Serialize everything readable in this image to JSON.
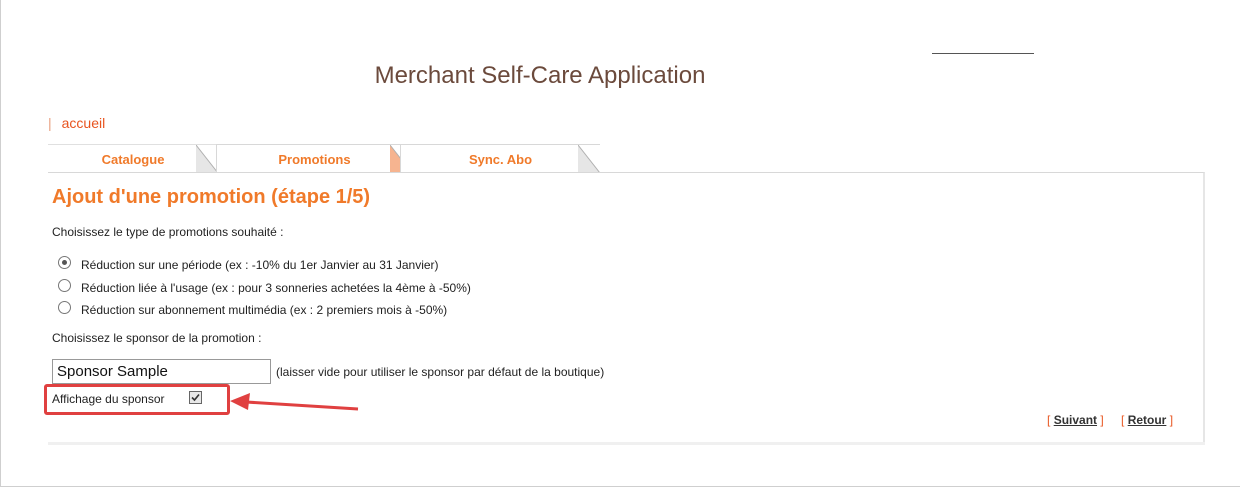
{
  "app": {
    "title": "Merchant Self-Care Application"
  },
  "breadcrumb": {
    "home_label": "accueil"
  },
  "tabs": [
    {
      "label": "Catalogue"
    },
    {
      "label": "Promotions"
    },
    {
      "label": "Sync. Abo"
    }
  ],
  "page": {
    "heading": "Ajout d'une promotion (étape 1/5)",
    "type_prompt": "Choisissez le type de promotions souhaité :",
    "promotion_types": [
      {
        "label": "Réduction sur une période",
        "hint": "(ex : -10% du 1er Janvier au 31 Janvier)",
        "selected": true
      },
      {
        "label": "Réduction liée à l'usage",
        "hint": "(ex : pour 3 sonneries achetées la 4ème à -50%)",
        "selected": false
      },
      {
        "label": "Réduction sur abonnement multimédia",
        "hint": "(ex : 2 premiers mois à -50%)",
        "selected": false
      }
    ],
    "sponsor_prompt": "Choisissez le sponsor de la promotion :",
    "sponsor_value": "Sponsor Sample",
    "sponsor_hint": "(laisser vide pour utiliser le sponsor par défaut de la boutique)",
    "sponsor_display_label": "Affichage du sponsor",
    "sponsor_display_checked": true
  },
  "nav": {
    "bracket_open": "[",
    "bracket_close": "]",
    "next_label": "Suivant",
    "back_label": "Retour"
  },
  "colors": {
    "accent": "#f07a2a",
    "link": "#e8541f",
    "title": "#6b4a3c",
    "annotation": "#e04040"
  }
}
